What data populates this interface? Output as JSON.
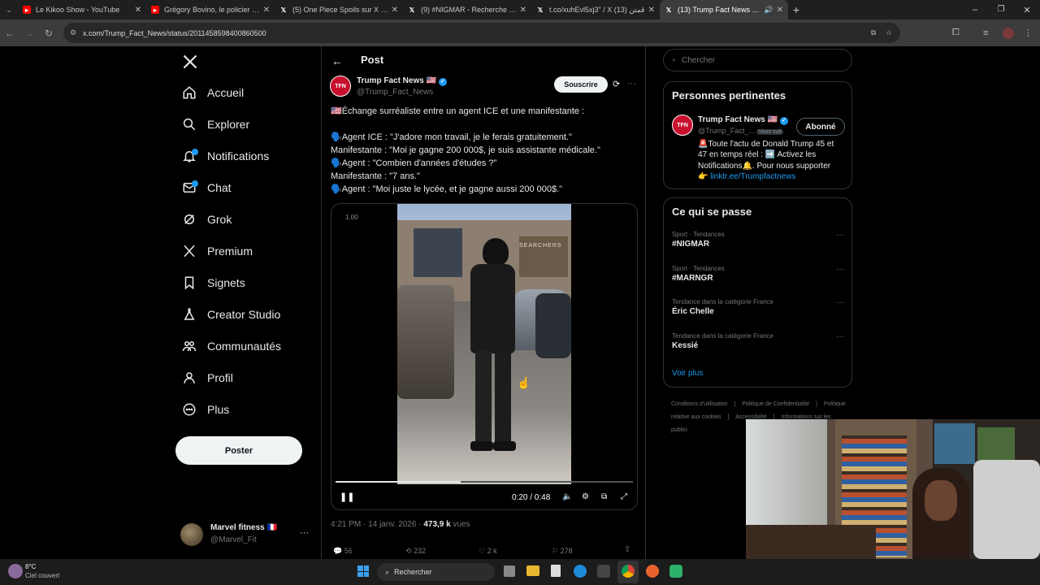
{
  "browser": {
    "tabs": [
      {
        "title": "Le Kikoo Show - YouTube",
        "icon": "youtube-icon",
        "active": false
      },
      {
        "title": "Grégory Bovino, le policier qui",
        "icon": "youtube-icon",
        "active": false
      },
      {
        "title": "(5) One Piece Spoils sur X : \"#O",
        "icon": "x-icon",
        "active": false
      },
      {
        "title": "(9) #NIGMAR - Recherche / X",
        "icon": "x-icon",
        "active": false
      },
      {
        "title": "t.co/xuhEvl5xj3\" / X قمتن (13)",
        "icon": "x-icon",
        "active": false
      },
      {
        "title": "(13) Trump Fact News us su",
        "icon": "x-icon",
        "active": true
      }
    ],
    "url": "x.com/Trump_Fact_News/status/2011458598400860500"
  },
  "nav": {
    "items": [
      {
        "label": "Accueil",
        "icon": "home-icon"
      },
      {
        "label": "Explorer",
        "icon": "search-icon"
      },
      {
        "label": "Notifications",
        "icon": "bell-icon"
      },
      {
        "label": "Chat",
        "icon": "mail-icon"
      },
      {
        "label": "Grok",
        "icon": "grok-icon"
      },
      {
        "label": "Premium",
        "icon": "x-logo-icon"
      },
      {
        "label": "Signets",
        "icon": "bookmark-icon"
      },
      {
        "label": "Creator Studio",
        "icon": "flask-icon"
      },
      {
        "label": "Communautés",
        "icon": "people-icon"
      },
      {
        "label": "Profil",
        "icon": "person-icon"
      },
      {
        "label": "Plus",
        "icon": "more-circle-icon"
      }
    ],
    "post_button": "Poster",
    "account": {
      "name": "Marvel fitness 🇫🇷",
      "handle": "@Marvel_Fit",
      "more": "···"
    }
  },
  "post": {
    "header_title": "Post",
    "author": {
      "name": "Trump Fact News 🇺🇸",
      "handle": "@Trump_Fact_News",
      "avatar_text": "TFN"
    },
    "subscribe_label": "Souscrire",
    "text_lines": [
      "🇺🇸Échange surréaliste entre un agent ICE et une manifestante :",
      "",
      "🗣️Agent ICE : \"J'adore mon travail, je le ferais gratuitement.\"",
      "Manifestante : \"Moi je gagne 200 000$, je suis assistante médicale.\"",
      "🗣️Agent : \"Combien d'années d'études ?\"",
      "Manifestante : \"7 ans.\"",
      "🗣️Agent : \"Moi juste le lycée, et je gagne aussi 200 000$.\""
    ],
    "video": {
      "speed": "1.00",
      "time": "0:20 / 0:48",
      "progress": 0.42,
      "storefront_text": "SEARCHERS"
    },
    "meta": {
      "time": "4:21 PM · 14 janv. 2026 · ",
      "views_count": "473,9 k",
      "views_label": " vues"
    },
    "stats": {
      "replies": "56",
      "reposts": "232",
      "likes": "2 k",
      "bookmarks": "278"
    }
  },
  "right": {
    "search_placeholder": "Chercher",
    "relevant": {
      "title": "Personnes pertinentes",
      "name": "Trump Fact News 🇺🇸",
      "handle": "@Trump_Fact_...",
      "follows_you": "Vous suit",
      "following_label": "Abonné",
      "bio_lines": [
        "🚨Toute l'actu de Donald Trump 45 et",
        "47 en temps réel : ➡️ Activez les",
        "Notifications🔔. Pour nous supporter",
        "👉"
      ],
      "bio_link": "linktr.ee/Trumpfactnews"
    },
    "trends": {
      "title": "Ce qui se passe",
      "items": [
        {
          "meta": "Sport · Tendances",
          "name": "#NIGMAR"
        },
        {
          "meta": "Sport · Tendances",
          "name": "#MARNGR"
        },
        {
          "meta": "Tendance dans la catégorie France",
          "name": "Éric Chelle"
        },
        {
          "meta": "Tendance dans la catégorie France",
          "name": "Kessié"
        }
      ],
      "more": "Voir plus"
    },
    "footer": [
      "Conditions d'utilisation",
      "Politique de Confidentialité",
      "Politique relative aux cookies",
      "Accessibilité",
      "Informations sur les publici"
    ]
  },
  "taskbar": {
    "weather_temp": "8°C",
    "weather_desc": "Ciel couvert",
    "search_label": "Rechercher"
  }
}
